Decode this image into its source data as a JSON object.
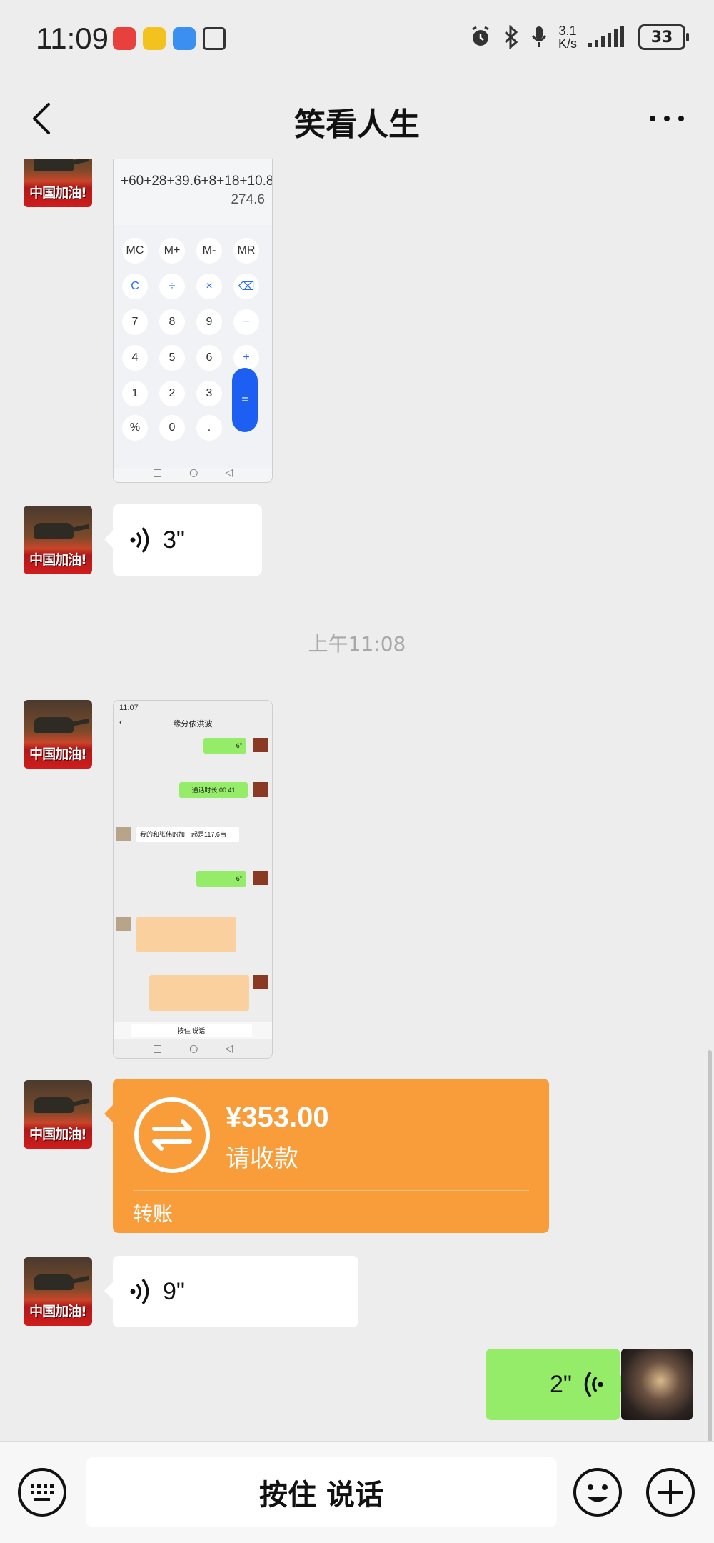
{
  "status_bar": {
    "time": "11:09",
    "net_speed_value": "3.1",
    "net_speed_unit": "K/s",
    "battery": "33"
  },
  "header": {
    "title": "笑看人生"
  },
  "avatar_label": "中国加油!",
  "messages": {
    "calc_screenshot": {
      "expression": "+60+28+39.6+8+18+10.8",
      "result": "274.6",
      "keys": [
        "MC",
        "M+",
        "M-",
        "MR",
        "C",
        "÷",
        "×",
        "⌫",
        "7",
        "8",
        "9",
        "−",
        "4",
        "5",
        "6",
        "+",
        "1",
        "2",
        "3",
        "=",
        "%",
        "0",
        "."
      ]
    },
    "voice_1": {
      "duration": "3\""
    },
    "timestamp_1": "上午11:08",
    "chat_screenshot": {
      "time": "11:07",
      "title": "缘分依洪波",
      "voice_a": "6\"",
      "call_duration": "通话时长 00:41",
      "text_msg": "我的和张伟的加一起是117.6亩",
      "voice_b": "6\"",
      "hold_to_talk": "按住 说话"
    },
    "transfer": {
      "amount": "¥353.00",
      "status": "请收款",
      "footer": "转账"
    },
    "voice_2": {
      "duration": "9\""
    },
    "voice_out": {
      "duration": "2\""
    }
  },
  "input_bar": {
    "talk_label": "按住 说话"
  }
}
